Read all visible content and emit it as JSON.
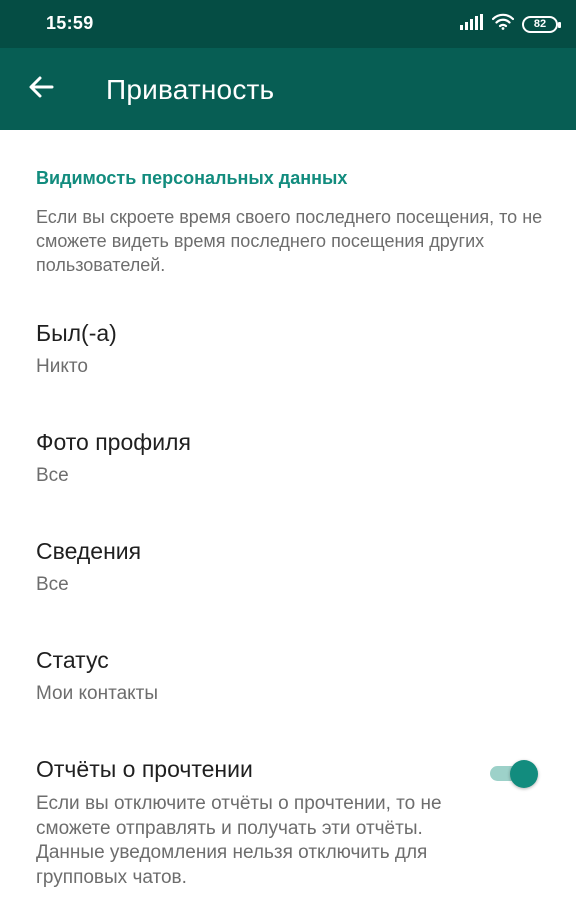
{
  "status_bar": {
    "time": "15:59",
    "battery": "82",
    "icons": [
      "signal-icon",
      "wifi-icon",
      "battery-icon"
    ]
  },
  "app_bar": {
    "title": "Приватность",
    "back_icon": "arrow-left-icon"
  },
  "section": {
    "title": "Видимость персональных данных",
    "description": "Если вы скроете время своего последнего посещения, то не сможете видеть время последнего посещения других пользователей."
  },
  "items": [
    {
      "title": "Был(-а)",
      "value": "Никто"
    },
    {
      "title": "Фото профиля",
      "value": "Все"
    },
    {
      "title": "Сведения",
      "value": "Все"
    },
    {
      "title": "Статус",
      "value": "Мои контакты"
    }
  ],
  "read_receipts": {
    "title": "Отчёты о прочтении",
    "description": "Если вы отключите отчёты о прочтении, то не сможете отправлять и получать эти отчёты. Данные уведомления нельзя отключить для групповых чатов.",
    "enabled": true
  },
  "colors": {
    "status_bar": "#054d44",
    "app_bar": "#075e54",
    "accent": "#128c7e",
    "toggle_track": "#9dd1c9"
  }
}
